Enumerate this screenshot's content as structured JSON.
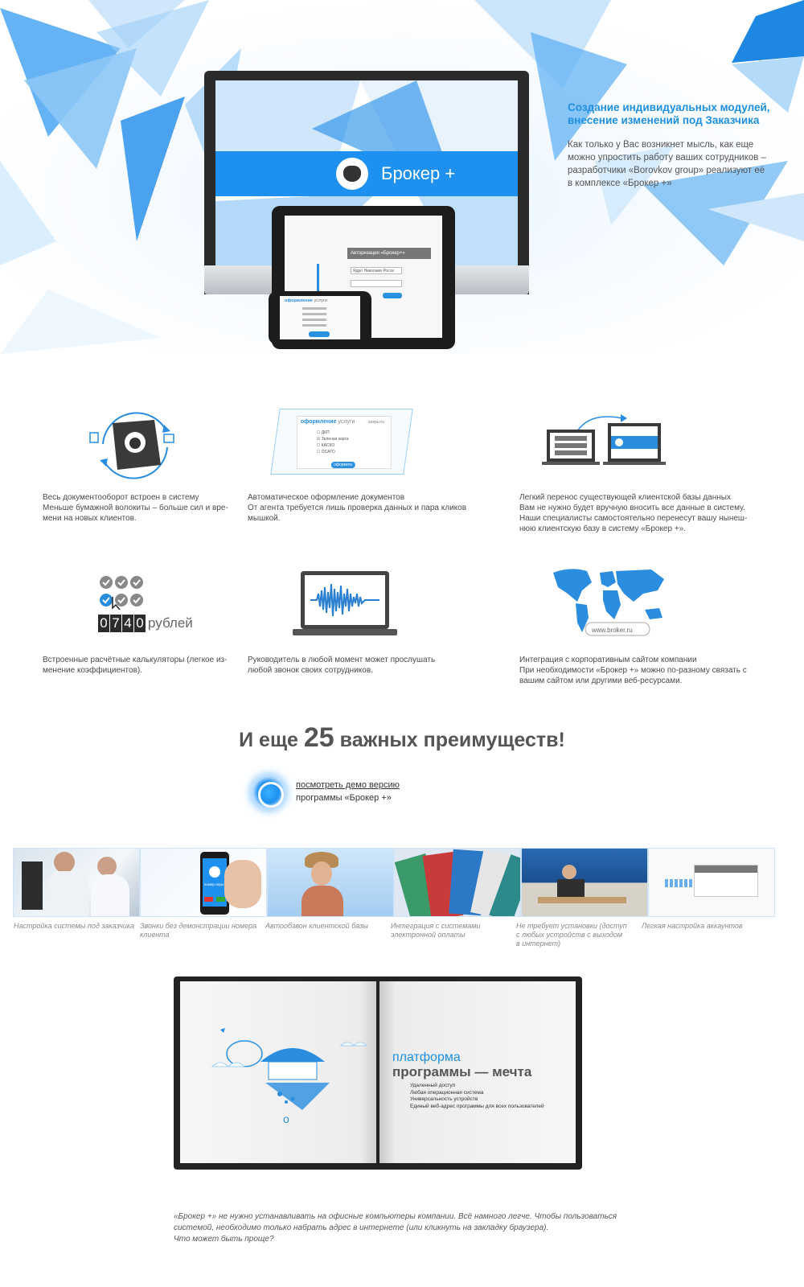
{
  "hero": {
    "title_line1": "Создание индивидуальных модулей,",
    "title_line2": "внесение изменений под Заказчика",
    "text_lines": [
      "Как только у Вас возникнет мысль, как еще",
      "можно упростить работу ваших сотрудников –",
      "разработчики «Borovkov group» реализуют её",
      "в комплексе «Брокер +»"
    ],
    "brand_name": "Брокер +",
    "tablet_auth": "Авторизация «Брокер+»",
    "tablet_field": "Ядро Николаев Росси",
    "phone_title": "оформление",
    "phone_title_rest": "услуги"
  },
  "features": [
    {
      "lines": [
        "Весь документооборот встроен в систему",
        "Меньше бумажной волокиты – больше сил и вре-",
        "мени на новых клиентов."
      ]
    },
    {
      "lines": [
        "Автоматическое оформление документов",
        "От агента требуется лишь проверка данных и пара кликов",
        "мышкой."
      ]
    },
    {
      "lines": [
        "Легкий перенос существующей клиентской базы данных",
        "Вам не нужно будет вручную вносить все данные в систему.",
        "Наши специалисты самостоятельно перенесут вашу нынеш-",
        "нюю клиентскую базу в систему «Брокер +»."
      ]
    },
    {
      "lines": [
        "Встроенные расчётные калькуляторы (легкое из-",
        "менение коэффициентов)."
      ]
    },
    {
      "lines": [
        "Руководитель в любой момент может прослушать",
        "любой звонок своих сотрудников."
      ]
    },
    {
      "lines": [
        "Интеграция с корпоративным сайтом компании",
        "При необходимости «Брокер +» можно по-разному связать с",
        "вашим сайтом или другими веб-ресурсами."
      ]
    }
  ],
  "doc_card": {
    "title": "оформление",
    "title_rest": "услуги",
    "toggle": "закрыть",
    "options": [
      "ДКП",
      "Зеленая карта",
      "КАСКО",
      "ОСАГО"
    ],
    "button": "оформить"
  },
  "calculator": {
    "digits": [
      "0",
      "7",
      "4",
      "0"
    ],
    "unit": "рублей"
  },
  "site_badge": "www.broker.ru",
  "headline": {
    "before": "И еще ",
    "number": "25",
    "after": " важных преимуществ!"
  },
  "demo": {
    "link": "посмотреть демо версию",
    "sub": "программы «Брокер +»"
  },
  "strip": [
    {
      "caption": [
        "Настройка системы под заказчика"
      ]
    },
    {
      "caption": [
        "Звонки без демонстрации номера",
        "клиента"
      ],
      "phone_text": "номер скрыт"
    },
    {
      "caption": [
        "Автообзвон клиентской базы"
      ]
    },
    {
      "caption": [
        "Интеграция с системами",
        "электронной оплаты"
      ]
    },
    {
      "caption": [
        "Не требует установки (доступ",
        "с любых устройств с выходом",
        "в интернет)"
      ]
    },
    {
      "caption": [
        "Легкая настройка аккаунтов"
      ]
    }
  ],
  "book": {
    "title1": "платформа",
    "title2": "программы — мечта",
    "list": [
      "Удаленный доступ",
      "Любая операционная система",
      "Универсальность устройств",
      "Единый веб-адрес программы для всех пользователей"
    ]
  },
  "bottom_text": [
    "«Брокер +» не нужно устанавливать на офисные компьютеры компании. Всё намного легче. Чтобы пользоваться",
    "системой, необходимо только набрать адрес в интернете (или кликнуть на закладку браузера).",
    "Что может быть проще?"
  ],
  "colors": {
    "accent": "#1e8fe0",
    "accent_dark": "#0f6fc9",
    "triangle_light": "#a9d3f7"
  }
}
